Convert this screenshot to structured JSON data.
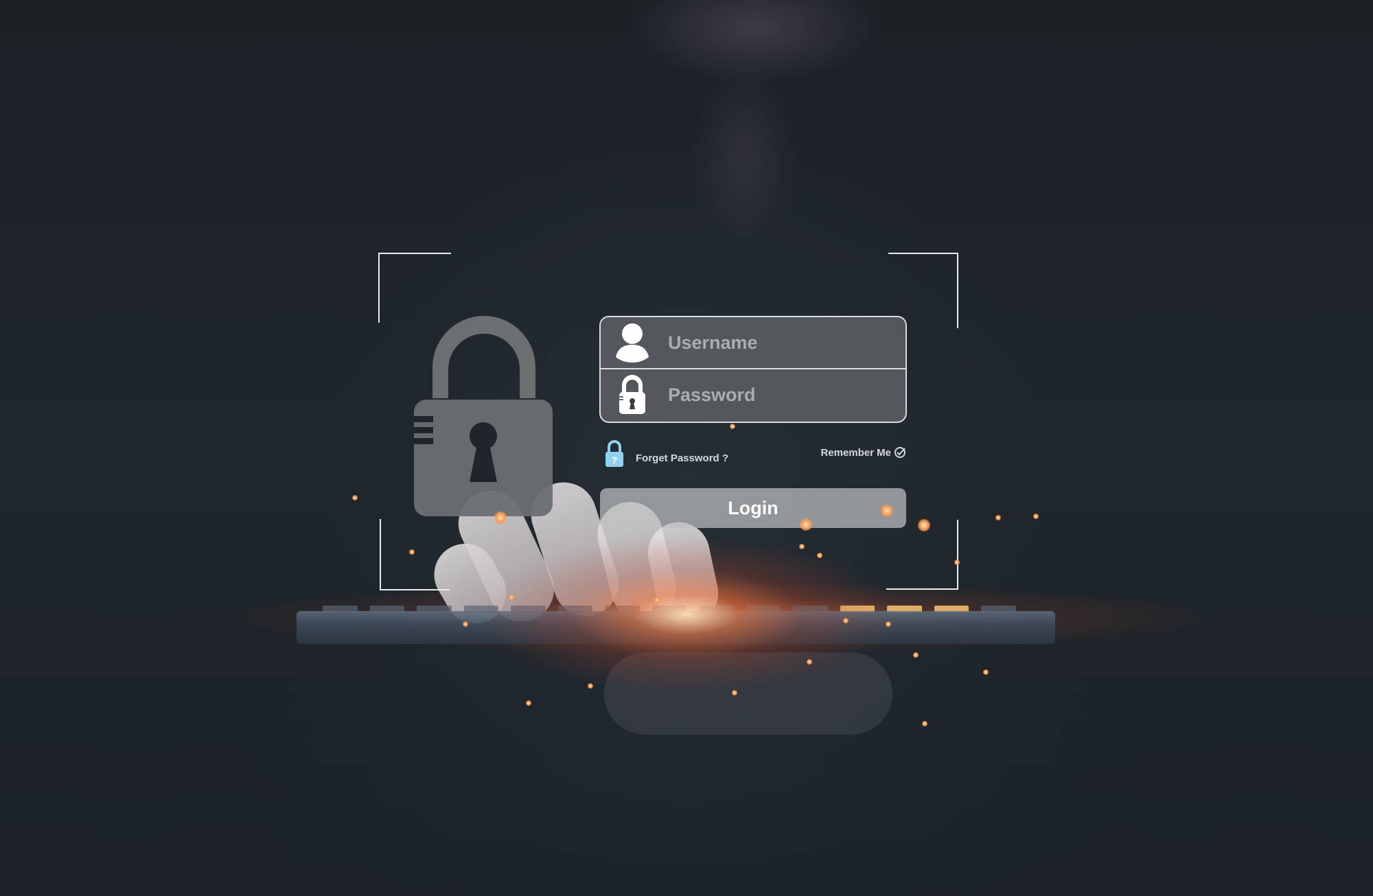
{
  "login_form": {
    "username_placeholder": "Username",
    "password_placeholder": "Password",
    "forgot_password_label": "Forget Password ?",
    "remember_me_label": "Remember Me",
    "login_button_label": "Login"
  },
  "icons": {
    "big_lock": "padlock-icon",
    "username": "user-icon",
    "password": "lock-icon",
    "forgot": "lock-question-icon",
    "remember": "check-circle-icon"
  },
  "colors": {
    "background": "#1e242a",
    "panel": "#64686c",
    "panel_border": "#d9dde0",
    "big_lock": "#6c6f72",
    "forgot_lock": "#8fd3f0",
    "login_button": "#bec0c2",
    "glow": "#ff8a4c"
  }
}
